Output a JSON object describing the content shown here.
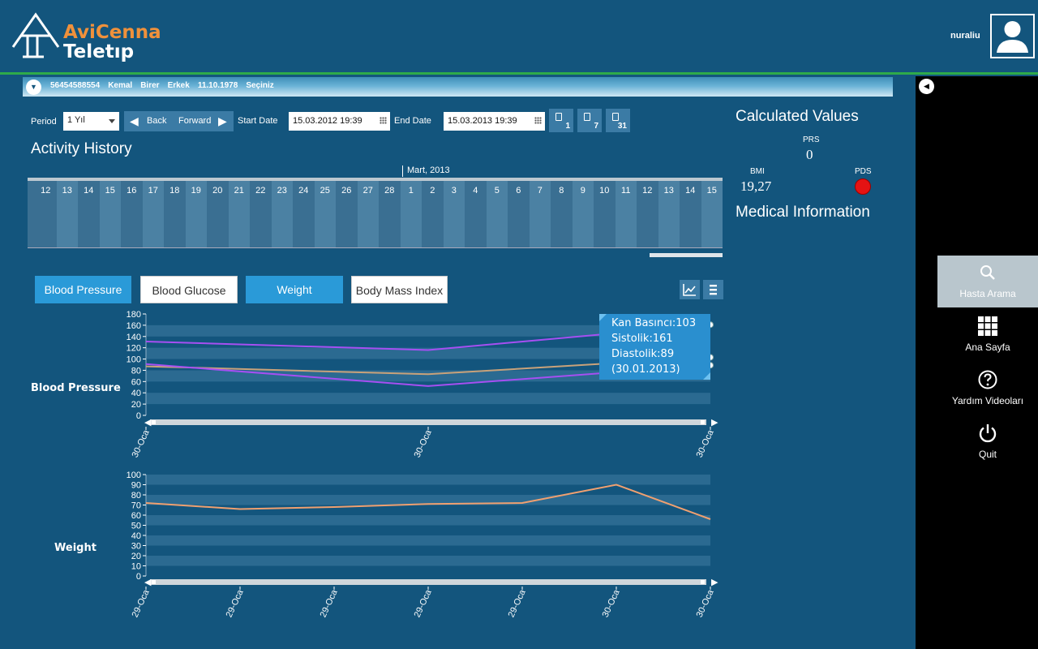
{
  "app": {
    "logo_top": "AviCenna",
    "logo_bottom": "Teletıp"
  },
  "header": {
    "username": "nuraliu"
  },
  "patient": {
    "id": "56454588554",
    "first_name": "Kemal",
    "last_name": "Birer",
    "gender": "Erkek",
    "birth_date": "11.10.1978",
    "select_label": "Seçiniz"
  },
  "filters": {
    "period_label": "Period",
    "period_value": "1 Yıl",
    "back_label": "Back",
    "forward_label": "Forward",
    "start_label": "Start Date",
    "start_value": "15.03.2012 19:39",
    "end_label": "End Date",
    "end_value": "15.03.2013 19:39",
    "quick_ranges": [
      "1",
      "7",
      "31"
    ]
  },
  "activity": {
    "title": "Activity History",
    "month_label": "Mart, 2013",
    "days": [
      "12",
      "13",
      "14",
      "15",
      "16",
      "17",
      "18",
      "19",
      "20",
      "21",
      "22",
      "23",
      "24",
      "25",
      "26",
      "27",
      "28",
      "1",
      "2",
      "3",
      "4",
      "5",
      "6",
      "7",
      "8",
      "9",
      "10",
      "11",
      "12",
      "13",
      "14",
      "15"
    ]
  },
  "tabs": [
    {
      "label": "Blood Pressure",
      "active": true
    },
    {
      "label": "Blood Glucose",
      "active": false
    },
    {
      "label": "Weight",
      "active": true
    },
    {
      "label": "Body Mass Index",
      "active": false
    }
  ],
  "calculated": {
    "title": "Calculated Values",
    "prs_label": "PRS",
    "prs_value": "0",
    "bmi_label": "BMI",
    "bmi_value": "19,27",
    "pds_label": "PDS",
    "pds_color": "#e41313"
  },
  "medical": {
    "title": "Medical Information"
  },
  "tooltip": {
    "line1": "Kan Basıncı:103",
    "line2": "Sistolik:161",
    "line3": "Diastolik:89",
    "line4": "(30.01.2013)"
  },
  "sidebar": {
    "items": [
      {
        "label": "Hasta Arama",
        "icon": "search-icon",
        "active": true
      },
      {
        "label": "Ana Sayfa",
        "icon": "grid-icon",
        "active": false
      },
      {
        "label": "Yardım Videoları",
        "icon": "help-icon",
        "active": false
      },
      {
        "label": "Quit",
        "icon": "power-icon",
        "active": false
      }
    ]
  },
  "colors": {
    "background": "#13557d",
    "accent": "#2a9ad8",
    "header_line": "#2eaa4a",
    "systolic": "#a64ff2",
    "diastolic": "#a64ff2",
    "pressure": "#c9a27a",
    "weight": "#f0a070"
  },
  "chart_data": [
    {
      "type": "line",
      "title": "Blood Pressure",
      "categories": [
        "30-Oca",
        "30-Oca",
        "30-Oca"
      ],
      "series": [
        {
          "name": "Sistolik",
          "values": [
            131,
            116,
            161
          ]
        },
        {
          "name": "Kan Basıncı",
          "values": [
            87,
            73,
            103
          ]
        },
        {
          "name": "Diastolik",
          "values": [
            91,
            52,
            89
          ]
        }
      ],
      "ylim": [
        0,
        180
      ],
      "yticks": [
        0,
        20,
        40,
        60,
        80,
        100,
        120,
        140,
        160,
        180
      ],
      "grid": true
    },
    {
      "type": "line",
      "title": "Weight",
      "categories": [
        "29-Oca",
        "29-Oca",
        "29-Oca",
        "29-Oca",
        "29-Oca",
        "30-Oca",
        "30-Oca"
      ],
      "series": [
        {
          "values": [
            72,
            66,
            68,
            71,
            72,
            90,
            56
          ]
        }
      ],
      "ylim": [
        0,
        100
      ],
      "yticks": [
        0,
        10,
        20,
        30,
        40,
        50,
        60,
        70,
        80,
        90,
        100
      ],
      "grid": true
    }
  ]
}
